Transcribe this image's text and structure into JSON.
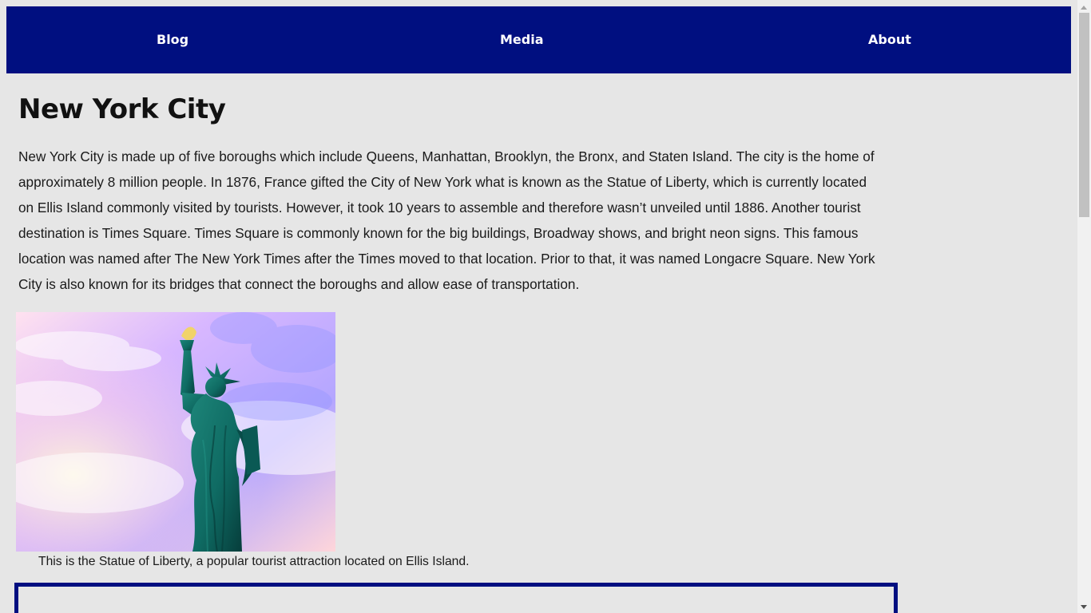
{
  "nav": {
    "items": [
      {
        "label": "Blog"
      },
      {
        "label": "Media"
      },
      {
        "label": "About"
      }
    ]
  },
  "article": {
    "title": "New York City",
    "body": "New York City is made up of five boroughs which include Queens, Manhattan, Brooklyn, the Bronx, and Staten Island. The city is the home of approximately 8 million people. In 1876, France gifted the City of New York what is known as the Statue of Liberty, which is currently located on Ellis Island commonly visited by tourists. However, it took 10 years to assemble and therefore wasn’t unveiled until 1886. Another tourist destination is Times Square. Times Square is commonly known for the big buildings, Broadway shows, and bright neon signs. This famous location was named after The New York Times after the Times moved to that location. Prior to that, it was named Longacre Square. New York City is also known for its bridges that connect the boroughs and allow ease of transportation.",
    "image": {
      "icon": "statue-of-liberty-image"
    },
    "caption": "This is the Statue of Liberty, a popular tourist attraction located on Ellis Island."
  },
  "colors": {
    "page_background": "#e6e6e6",
    "navbar_background": "#000f80",
    "navbar_text": "#ffffff",
    "body_text": "#1a1a1a",
    "statue": "#0f6b63",
    "sky_top": "#9fa2ff",
    "sky_bottom": "#ffd3dc"
  }
}
